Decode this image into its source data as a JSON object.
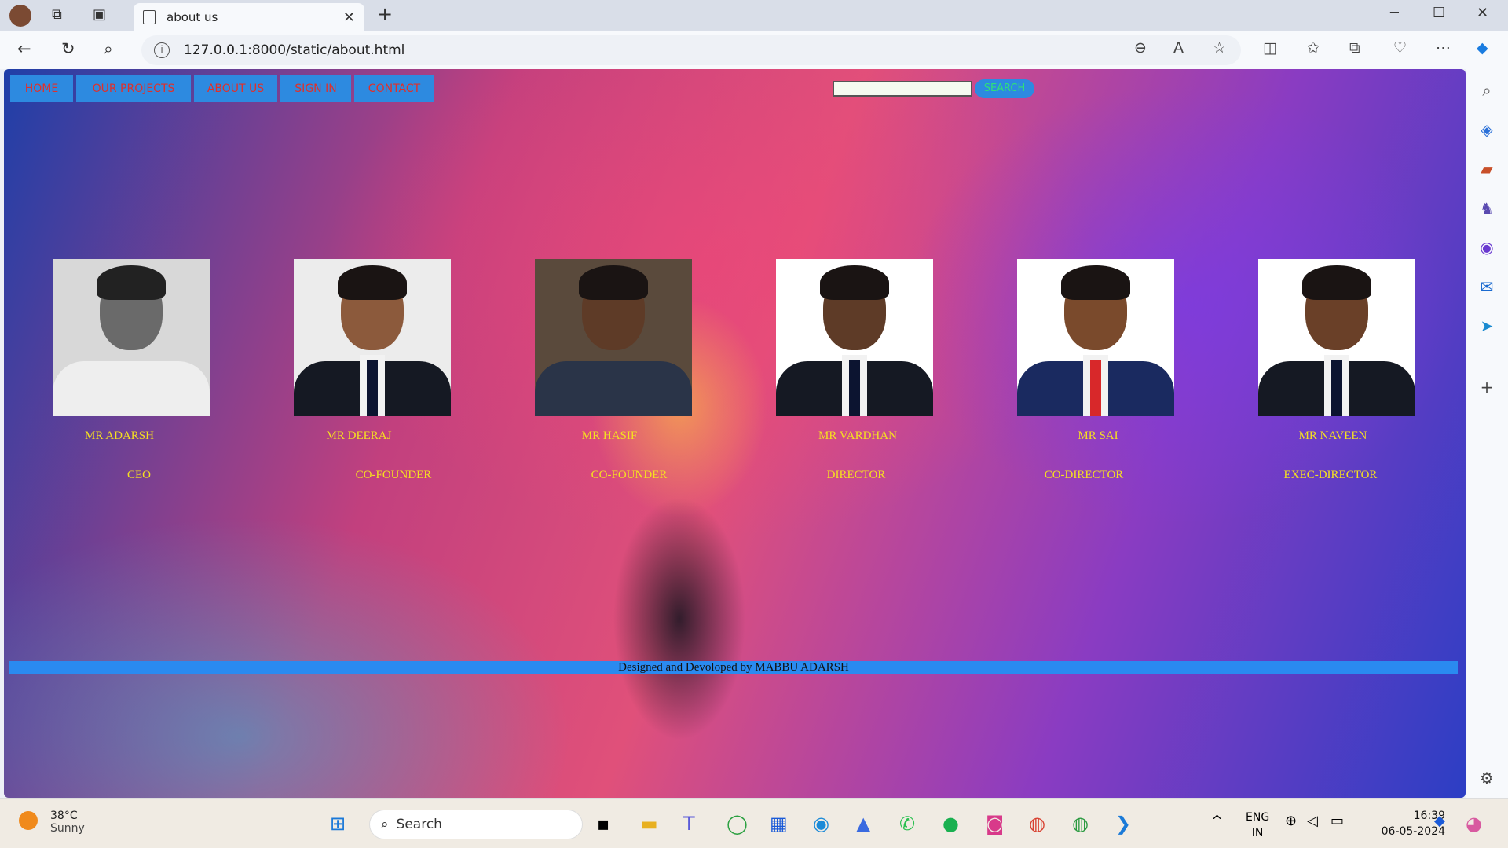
{
  "browser": {
    "tab_title": "about us",
    "url": "127.0.0.1:8000/static/about.html",
    "new_tab": "+",
    "tab_close": "✕",
    "controls": {
      "minimize": "─",
      "maximize": "☐",
      "close": "✕"
    }
  },
  "site": {
    "menu": [
      "HOME",
      "OUR PROJECTS",
      "ABOUT US",
      "SIGN IN",
      "CONTACT"
    ],
    "search_button": "SEARCH",
    "search_placeholder": "",
    "team": [
      {
        "name": "MR ADARSH",
        "role": "CEO"
      },
      {
        "name": "MR DEERAJ",
        "role": "CO-FOUNDER"
      },
      {
        "name": "MR HASIF",
        "role": "CO-FOUNDER"
      },
      {
        "name": "MR VARDHAN",
        "role": "DIRECTOR"
      },
      {
        "name": "MR SAI",
        "role": "CO-DIRECTOR"
      },
      {
        "name": "MR NAVEEN",
        "role": "EXEC-DIRECTOR"
      }
    ],
    "footer": "Designed and Devoloped by MABBU ADARSH"
  },
  "taskbar": {
    "weather_temp": "38°C",
    "weather_desc": "Sunny",
    "search": "Search",
    "lang": "ENG",
    "region": "IN",
    "time": "16:39",
    "date": "06-05-2024"
  },
  "colors": {
    "menu_bg": "#2d8ae0",
    "menu_text": "#e0302a",
    "team_text": "#f5e020",
    "footer_bg": "#2a8af0"
  }
}
